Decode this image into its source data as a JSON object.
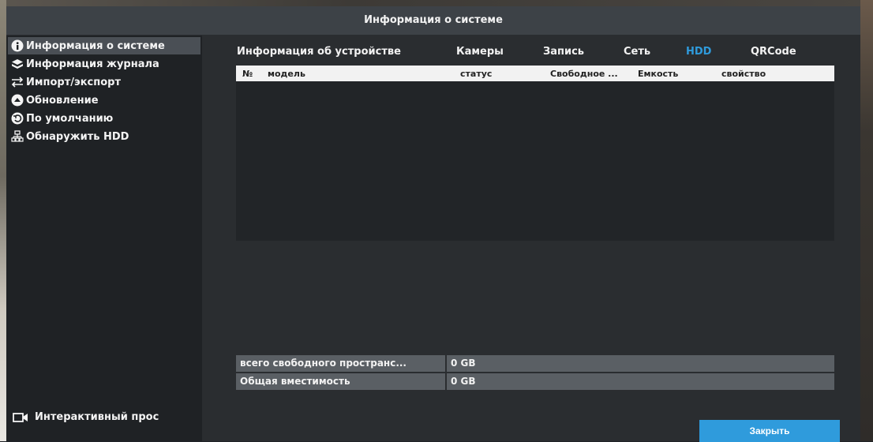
{
  "window": {
    "title": "Информация о системе"
  },
  "sidebar": {
    "items": [
      {
        "label": "Информация о системе",
        "icon": "info-icon",
        "active": true
      },
      {
        "label": "Информация журнала",
        "icon": "log-icon",
        "active": false
      },
      {
        "label": "Импорт/экспорт",
        "icon": "import-export-icon",
        "active": false
      },
      {
        "label": "Обновление",
        "icon": "upload-icon",
        "active": false
      },
      {
        "label": "По умолчанию",
        "icon": "reset-icon",
        "active": false
      },
      {
        "label": "Обнаружить HDD",
        "icon": "network-icon",
        "active": false
      }
    ],
    "bottom": {
      "label": "Интерактивный прос",
      "icon": "camera-icon"
    }
  },
  "tabs": [
    {
      "label": "Информация об устройстве",
      "active": false
    },
    {
      "label": "Камеры",
      "active": false
    },
    {
      "label": "Запись",
      "active": false
    },
    {
      "label": "Сеть",
      "active": false
    },
    {
      "label": "HDD",
      "active": true
    },
    {
      "label": "QRCode",
      "active": false
    }
  ],
  "table": {
    "columns": [
      "№",
      "модель",
      "статус",
      "Свободное ...",
      "Емкость",
      "свойство"
    ],
    "rows": []
  },
  "summary": [
    {
      "label": "всего свободного пространс...",
      "value": "0 GB"
    },
    {
      "label": "Общая вместимость",
      "value": "0 GB"
    }
  ],
  "buttons": {
    "close": "Закрыть"
  },
  "colors": {
    "accent": "#2f9bdc",
    "sidebar_active": "#4a4f55",
    "panel": "#2a2d30"
  }
}
